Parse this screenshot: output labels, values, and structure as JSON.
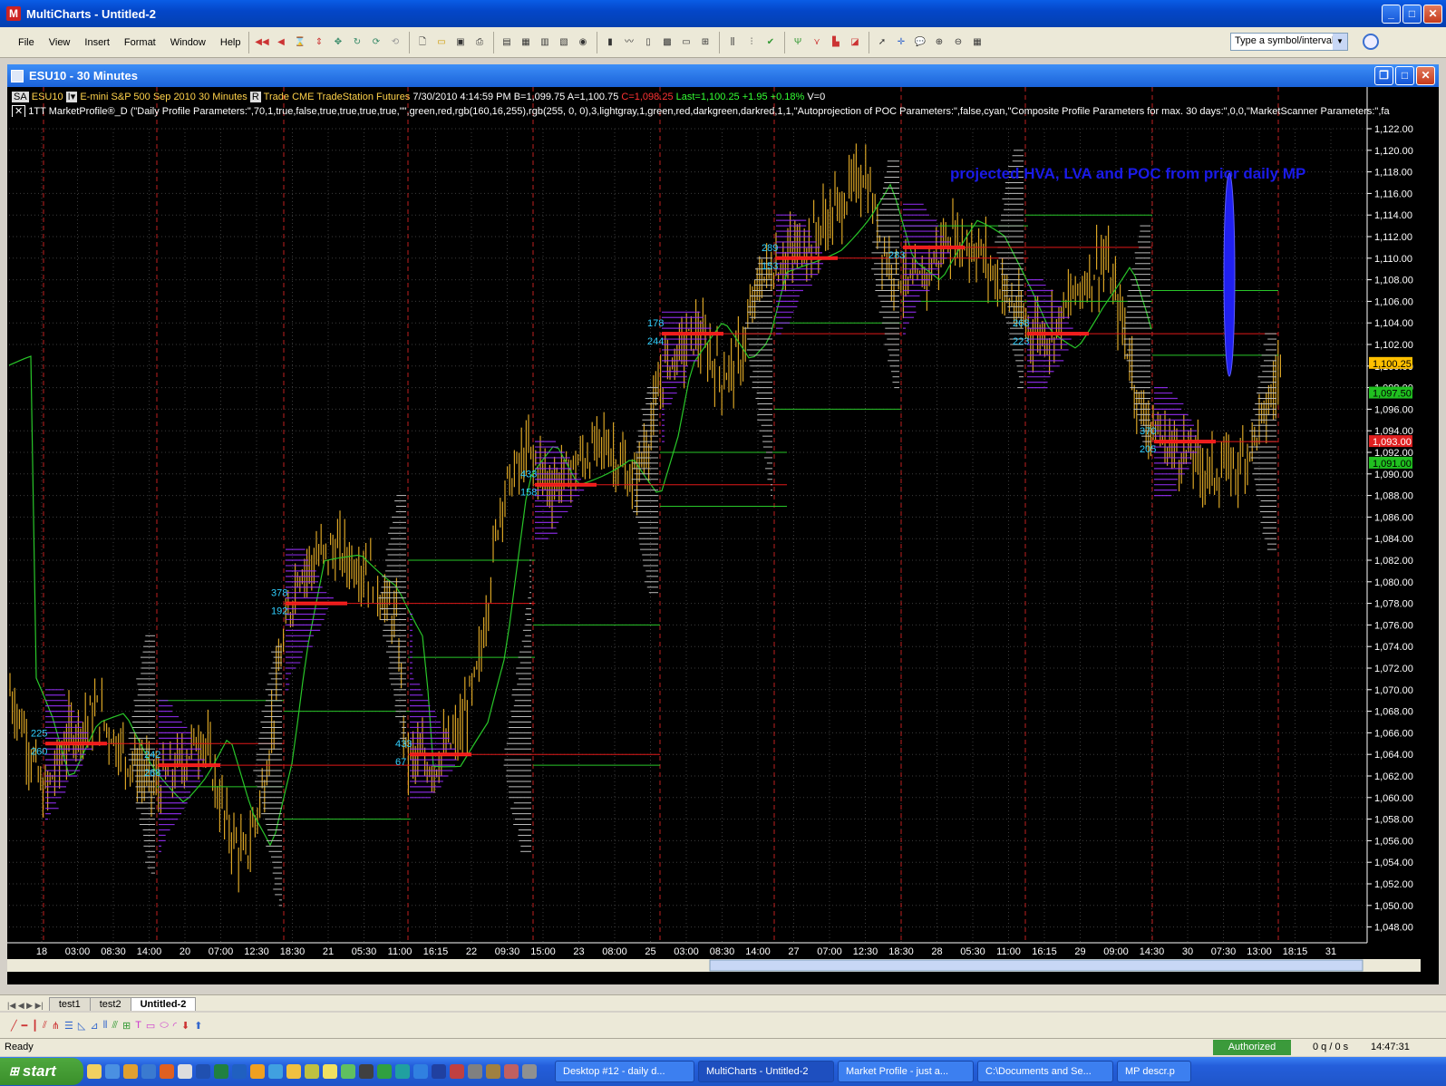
{
  "window": {
    "title": "MultiCharts - Untitled-2",
    "min": "_",
    "max": "□",
    "close": "✕"
  },
  "menu": [
    "File",
    "View",
    "Insert",
    "Format",
    "Window",
    "Help"
  ],
  "toolbar": {
    "symbol_placeholder": "Type a symbol/interval",
    "dd": "▼"
  },
  "chart_window": {
    "title": "ESU10 - 30 Minutes"
  },
  "status_line": {
    "mode": "SA",
    "symbol": "ESU10",
    "description": "E-mini S&P 500 Sep 2010",
    "interval": "30 Minutes",
    "session": "R",
    "trade": "Trade",
    "exchange": "CME",
    "source": "TradeStation",
    "type": "Futures",
    "datetime": "7/30/2010 4:14:59 PM",
    "bid": "B=1,099.75",
    "ask": "A=1,100.75",
    "close": "C=1,098.25",
    "last": "Last=1,100.25",
    "change": "+1.95",
    "pct": "+0.18%",
    "vol": "V=0"
  },
  "indicator_line": "1TT MarketProfile®_D  (\"Daily Profile Parameters:\",70,1,true,false,true,true,true,true,\"\",green,red,rgb(160,16,255),rgb(255, 0,  0),3,lightgray,1,green,red,darkgreen,darkred,1,1,\"Autoprojection of POC Parameters:\",false,cyan,\"Composite Profile Parameters for max. 30 days:\",0,0,\"MarketScanner Parameters:\",false",
  "annotation": "projected HVA, LVA and POC from prior daily MP",
  "price_labels": {
    "last": "1,100.25",
    "green_high": "1,097.50",
    "red": "1,093.00",
    "green_low": "1,091.00"
  },
  "y_ticks": [
    "1,122.00",
    "1,120.00",
    "1,118.00",
    "1,116.00",
    "1,114.00",
    "1,112.00",
    "1,110.00",
    "1,108.00",
    "1,106.00",
    "1,104.00",
    "1,102.00",
    "1,100.00",
    "1,098.00",
    "1,096.00",
    "1,094.00",
    "1,092.00",
    "1,090.00",
    "1,088.00",
    "1,086.00",
    "1,084.00",
    "1,082.00",
    "1,080.00",
    "1,078.00",
    "1,076.00",
    "1,074.00",
    "1,072.00",
    "1,070.00",
    "1,068.00",
    "1,066.00",
    "1,064.00",
    "1,062.00",
    "1,060.00",
    "1,058.00",
    "1,056.00",
    "1,054.00",
    "1,052.00",
    "1,050.00",
    "1,048.00"
  ],
  "x_ticks": [
    "18",
    "03:00",
    "08:30",
    "14:00",
    "20",
    "07:00",
    "12:30",
    "18:30",
    "21",
    "05:30",
    "11:00",
    "16:15",
    "22",
    "09:30",
    "15:00",
    "23",
    "08:00",
    "25",
    "03:00",
    "08:30",
    "14:00",
    "27",
    "07:00",
    "12:30",
    "18:30",
    "28",
    "05:30",
    "11:00",
    "16:15",
    "29",
    "09:00",
    "14:30",
    "30",
    "07:30",
    "13:00",
    "18:15",
    "31"
  ],
  "profile_labels": [
    {
      "a": "225",
      "b": "260"
    },
    {
      "a": "242",
      "b": "268"
    },
    {
      "a": "378",
      "b": "192"
    },
    {
      "a": "433",
      "b": "67"
    },
    {
      "a": "433",
      "b": "158"
    },
    {
      "a": "178",
      "b": "244"
    },
    {
      "a": "289",
      "b": "153"
    },
    {
      "a": "",
      "b": "283"
    },
    {
      "a": "268",
      "b": "223"
    },
    {
      "a": "370",
      "b": "205"
    }
  ],
  "tabs": [
    "test1",
    "test2",
    "Untitled-2"
  ],
  "status": {
    "ready": "Ready",
    "auth": "Authorized",
    "orders": "0 q / 0 s",
    "time": "14:47:31"
  },
  "taskbar": {
    "start": "start",
    "tasks": [
      "Desktop #12 - daily d...",
      "MultiCharts - Untitled-2",
      "Market Profile - just a...",
      "C:\\Documents and Se...",
      "MP descr.p"
    ]
  },
  "colors": {
    "bars": "#d9a425",
    "green": "#29c629",
    "red": "#e01818",
    "profile": "#9b30ff",
    "annotation": "#1a1ae8",
    "grid": "#3c3c3c",
    "session": "#c02020"
  }
}
